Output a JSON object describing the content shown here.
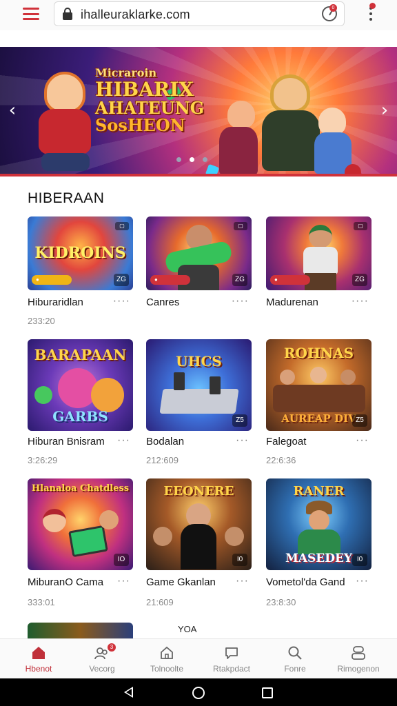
{
  "browser": {
    "url": "ihalleuraklarke.com",
    "timer_badge": "0",
    "menu_icon": "hamburger-icon",
    "lock_icon": "lock-icon"
  },
  "hero": {
    "title_line1": "Micraroin",
    "title_line2": "HIBARIX",
    "title_line3": "AHATEUNG",
    "title_line4": "SosHEON",
    "prev_arrow": "‹",
    "next_arrow": "›",
    "slide_count": 3,
    "active_slide": 2
  },
  "section": {
    "title": "HIBERAAN"
  },
  "cards": [
    {
      "title": "Hiburaridlan",
      "meta": "233:20",
      "thumb_text": "KIDROINS",
      "pill": "",
      "badge": "",
      "corner": "ZG",
      "more": "····"
    },
    {
      "title": "Canres",
      "meta": "",
      "thumb_text": "",
      "pill": "",
      "badge": "",
      "corner": "ZG",
      "more": "····"
    },
    {
      "title": "Madurenan",
      "meta": "",
      "thumb_text": "",
      "pill": "",
      "badge": "",
      "corner": "ZG",
      "more": "····"
    },
    {
      "title": "Hiburan Bnisram",
      "meta": "3:26:29",
      "thumb_text": "BARAPAAN",
      "thumb_text2": "GARBS",
      "corner": "",
      "more": "···"
    },
    {
      "title": "Bodalan",
      "meta": "212:609",
      "thumb_text": "UHCS",
      "thumb_text2": "",
      "corner": "Z5",
      "more": "···"
    },
    {
      "title": "Falegoat",
      "meta": "22:6:36",
      "thumb_text": "ROHNAS",
      "thumb_text2": "AUREAP DIV",
      "corner": "Z5",
      "more": "···"
    },
    {
      "title": "MiburanO Cama",
      "meta": "333:01",
      "thumb_text": "Hlanaloa Chatdless",
      "thumb_text2": "",
      "corner": "IO",
      "more": "···"
    },
    {
      "title": "Game Gkanlan",
      "meta": "21:609",
      "thumb_text": "EEONERE",
      "thumb_text2": "",
      "corner": "I0",
      "more": "···"
    },
    {
      "title": "Vometol'da Gand",
      "meta": "23:8:30",
      "thumb_text": "RANER",
      "thumb_text2": "MASEDEY",
      "corner": "I0",
      "more": "···"
    }
  ],
  "partial_label": "YOA",
  "bottom_nav": [
    {
      "label": "Hbenot",
      "icon": "home-icon",
      "active": true
    },
    {
      "label": "Vecorg",
      "icon": "users-icon",
      "badge": "3"
    },
    {
      "label": "Tolnoolte",
      "icon": "house-outline-icon"
    },
    {
      "label": "Rtakpdact",
      "icon": "chat-icon"
    },
    {
      "label": "Fonre",
      "icon": "search-icon"
    },
    {
      "label": "Rimogenon",
      "icon": "profile-icon"
    }
  ],
  "colors": {
    "accent": "#d0323a",
    "muted_text": "#888888"
  }
}
